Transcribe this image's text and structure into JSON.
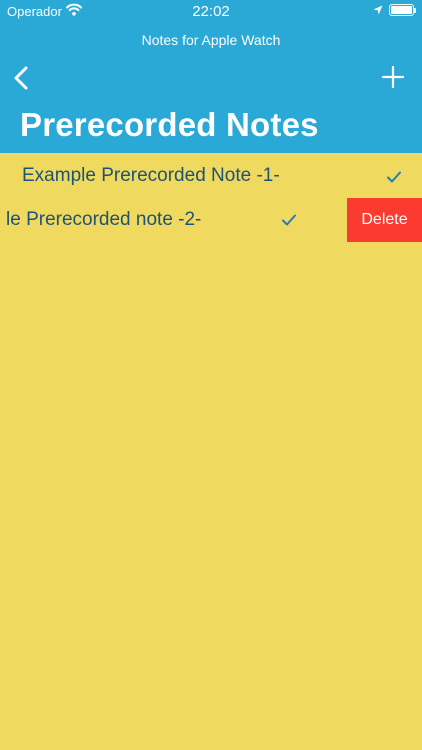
{
  "status_bar": {
    "carrier": "Operador",
    "time": "22:02"
  },
  "nav": {
    "app_title": "Notes for Apple Watch",
    "large_title": "Prerecorded Notes"
  },
  "notes": [
    {
      "title": "Example Prerecorded Note -1-",
      "checked": true
    },
    {
      "title": "le Prerecorded note -2-",
      "checked": true
    }
  ],
  "actions": {
    "delete_label": "Delete"
  },
  "colors": {
    "header": "#2aa9d7",
    "background": "#efd95e",
    "delete": "#fb3b30",
    "text": "#1f5277"
  },
  "icons": [
    "wifi-icon",
    "location-arrow-icon",
    "battery-icon",
    "back-chevron-icon",
    "plus-icon",
    "checkmark-icon"
  ]
}
